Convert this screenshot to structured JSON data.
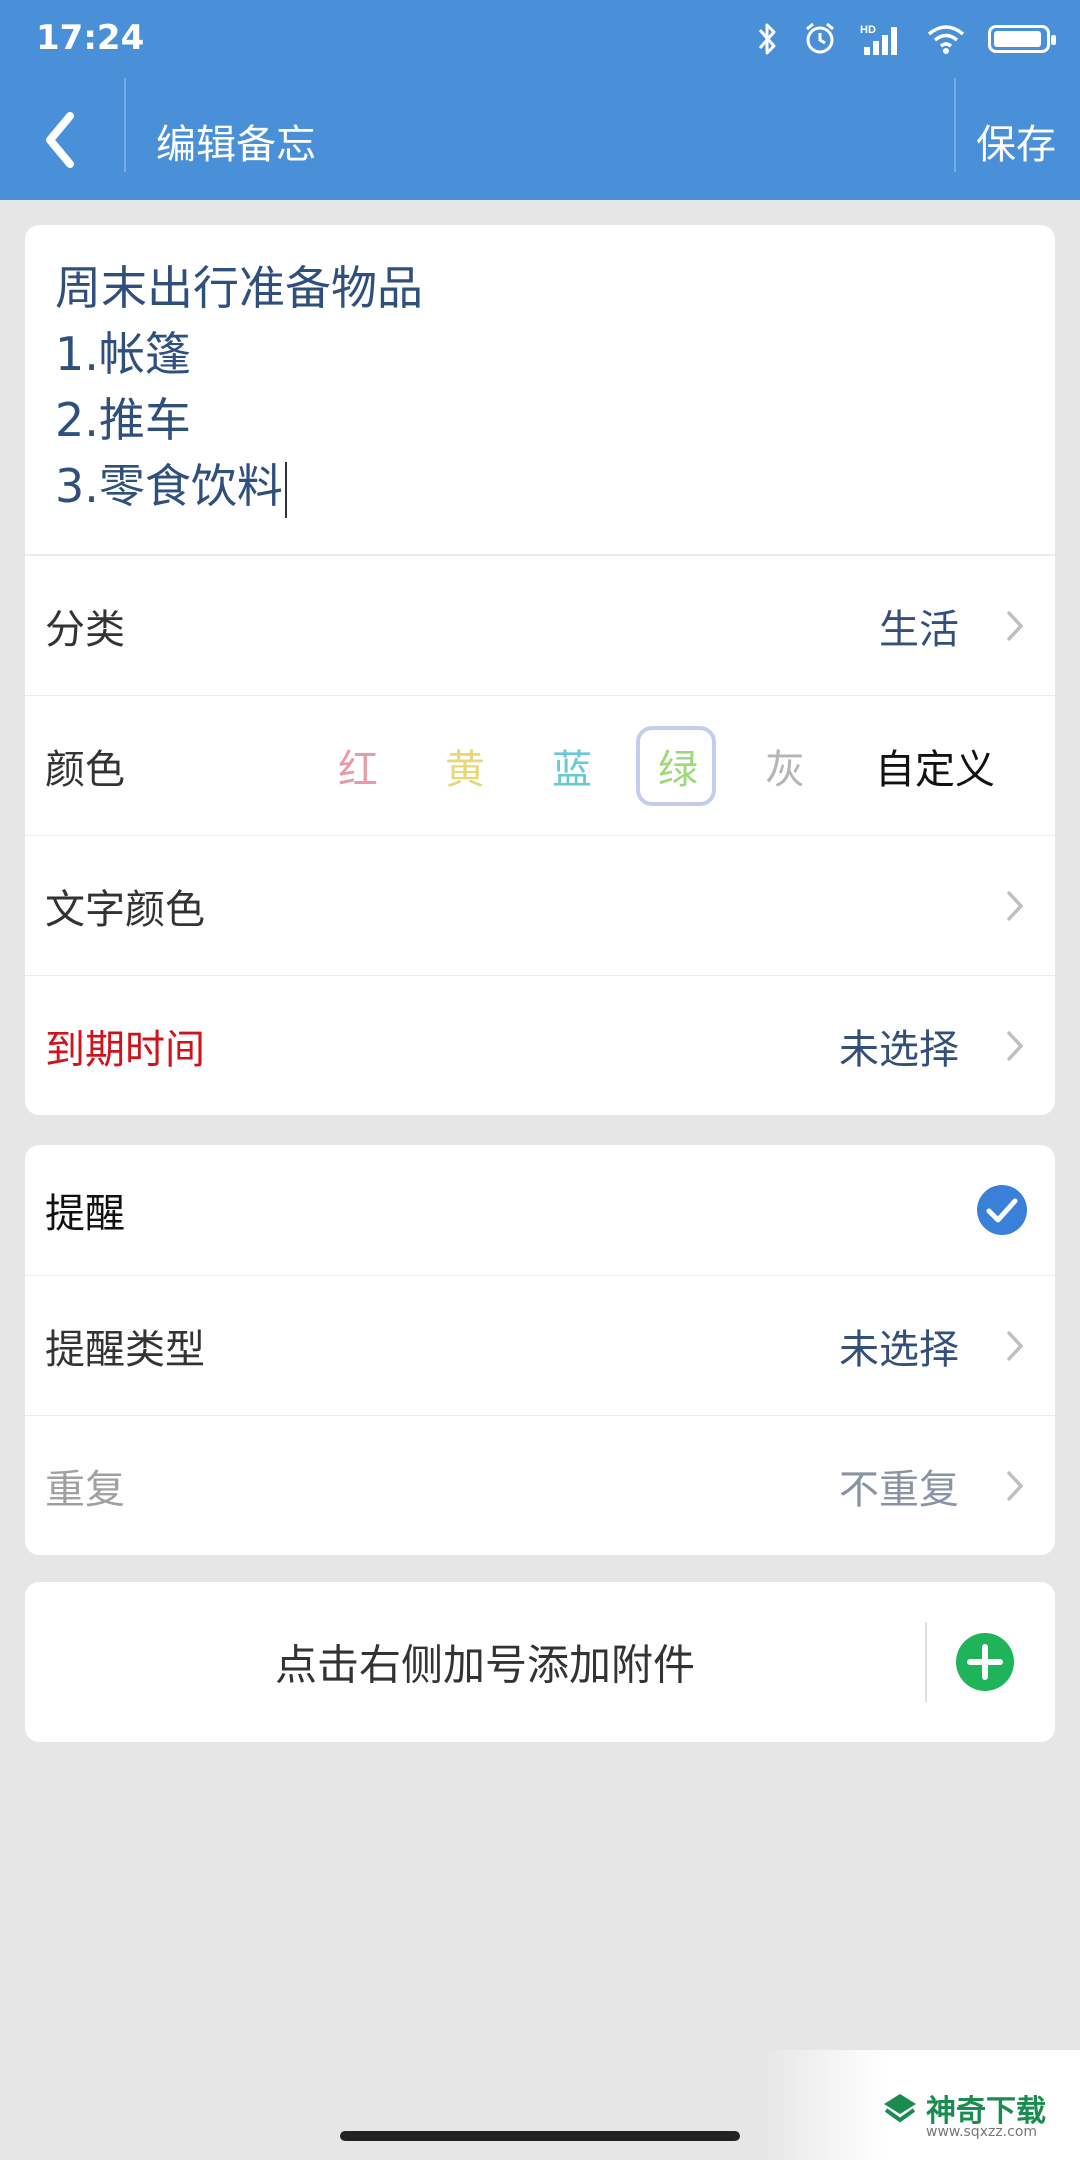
{
  "status_bar": {
    "time": "17:24",
    "hd_label": "HD"
  },
  "nav": {
    "title": "编辑备忘",
    "save_label": "保存"
  },
  "note": {
    "lines": [
      "周末出行准备物品",
      "1.帐篷",
      "2.推车",
      "3.零食饮料"
    ]
  },
  "rows": {
    "category": {
      "label": "分类",
      "value": "生活"
    },
    "color": {
      "label": "颜色",
      "options": [
        {
          "label": "红",
          "color": "#e89aa6"
        },
        {
          "label": "黄",
          "color": "#e6d874"
        },
        {
          "label": "蓝",
          "color": "#6bc9d2"
        },
        {
          "label": "绿",
          "color": "#9ed97a",
          "selected": true
        },
        {
          "label": "灰",
          "color": "#b5b5b5"
        }
      ],
      "custom_label": "自定义"
    },
    "text_color": {
      "label": "文字颜色"
    },
    "due_time": {
      "label": "到期时间",
      "value": "未选择",
      "label_color": "#d0121b"
    }
  },
  "reminder": {
    "toggle": {
      "label": "提醒",
      "checked": true
    },
    "type": {
      "label": "提醒类型",
      "value": "未选择"
    },
    "repeat": {
      "label": "重复",
      "value": "不重复"
    }
  },
  "attachment": {
    "text": "点击右侧加号添加附件"
  },
  "watermark": {
    "text": "神奇下载",
    "sub": "www.sqxzz.com"
  },
  "theme": {
    "accent": "#4a90d9",
    "check_blue": "#3a7fd8",
    "plus_green": "#1fb35a"
  }
}
